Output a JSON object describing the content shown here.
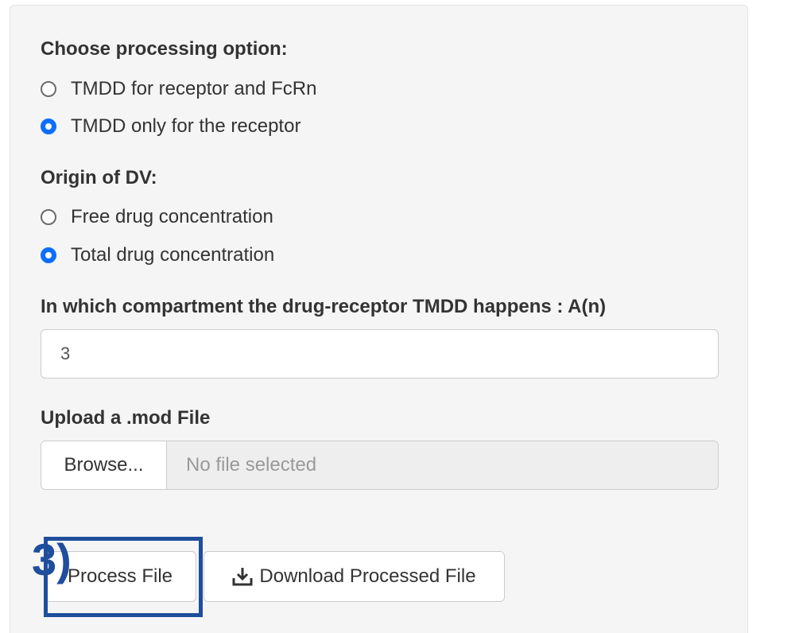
{
  "processing": {
    "label": "Choose processing option:",
    "options": [
      {
        "label": "TMDD for receptor and FcRn",
        "checked": false
      },
      {
        "label": "TMDD only for the receptor",
        "checked": true
      }
    ]
  },
  "origin": {
    "label": "Origin of DV:",
    "options": [
      {
        "label": "Free drug concentration",
        "checked": false
      },
      {
        "label": "Total drug concentration",
        "checked": true
      }
    ]
  },
  "compartment": {
    "label": "In which compartment the drug-receptor TMDD happens : A(n)",
    "value": "3"
  },
  "upload": {
    "label": "Upload a .mod File",
    "browse_label": "Browse...",
    "placeholder": "No file selected"
  },
  "actions": {
    "process_label": "Process File",
    "download_label": "Download Processed File",
    "download_icon": "download-icon"
  },
  "annotation": {
    "label": "3)",
    "color": "#1f4e9c"
  },
  "colors": {
    "accent": "#0d6efd",
    "panel_bg": "#f5f5f5"
  }
}
